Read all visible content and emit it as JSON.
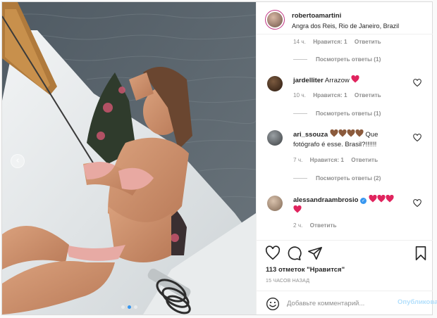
{
  "post": {
    "username": "robertoamartini",
    "location": "Angra dos Reis, Rio de Janeiro, Brazil",
    "photo_alt": "photo",
    "carousel_dots": 3,
    "active_dot": 1
  },
  "top_partial": {
    "time": "14 ч.",
    "likes": "Нравится: 1",
    "reply": "Ответить"
  },
  "comments": [
    {
      "view_replies": "Посмотреть ответы (1)"
    },
    {
      "user": "jardelliter",
      "text": "Arrazow",
      "emoji": "red-heart",
      "time": "10 ч.",
      "likes": "Нравится: 1",
      "reply": "Ответить",
      "view_replies": "Посмотреть ответы (1)"
    },
    {
      "user": "ari_ssouza",
      "text": "Que fotógrafo é esse. Brasil?!!!!!!",
      "emoji": "brown-hearts",
      "time": "7 ч.",
      "likes": "Нравится: 1",
      "reply": "Ответить",
      "view_replies": "Посмотреть ответы (2)"
    },
    {
      "user": "alessandraambrosio",
      "verified": true,
      "emoji": "red-hearts",
      "time": "2 ч.",
      "reply": "Ответить"
    }
  ],
  "actions": {
    "likes": "113 отметок \"Нравится\"",
    "timeago": "15 ЧАСОВ НАЗАД"
  },
  "add_comment": {
    "placeholder": "Добавьте комментарий...",
    "post_label": "Опубликовать"
  },
  "colors": {
    "brand_link": "#3897f0",
    "post_disabled": "#b2dffc",
    "heart_red": "#ed4956",
    "heart_brown": "#8b5a3c"
  }
}
